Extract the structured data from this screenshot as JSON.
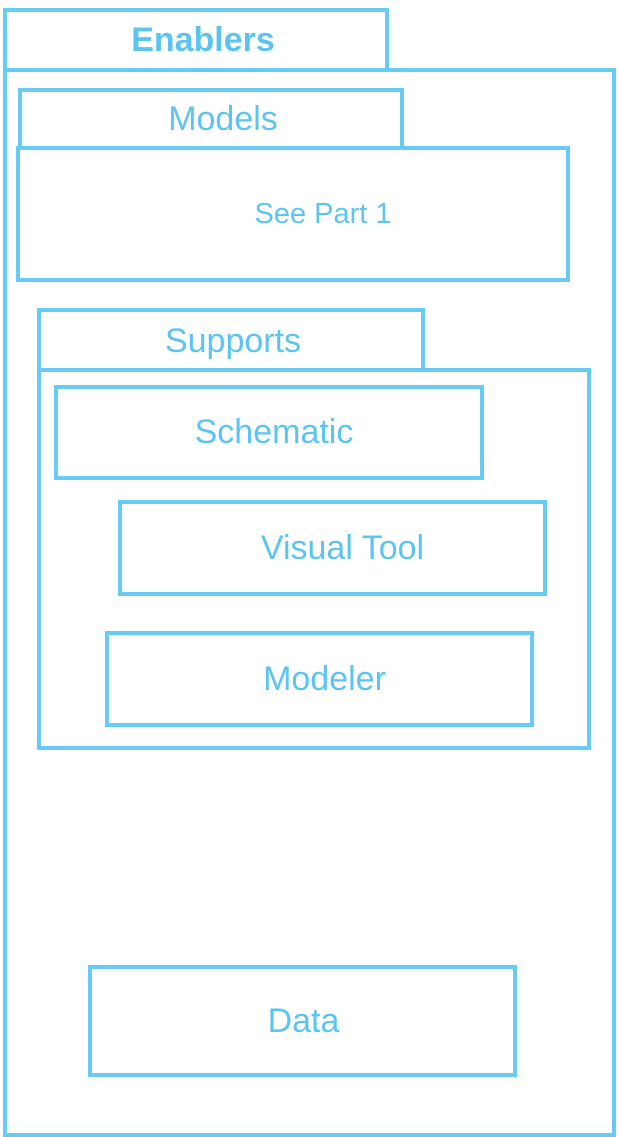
{
  "colors": {
    "stroke": "#66ccf5",
    "text": "#5cc4f2",
    "background": "#ffffff"
  },
  "enablers": {
    "title": "Enablers"
  },
  "models": {
    "title": "Models",
    "content": "See Part 1"
  },
  "supports": {
    "title": "Supports",
    "items": [
      "Schematic",
      "Visual Tool",
      "Modeler"
    ]
  },
  "data_box": {
    "label": "Data"
  }
}
